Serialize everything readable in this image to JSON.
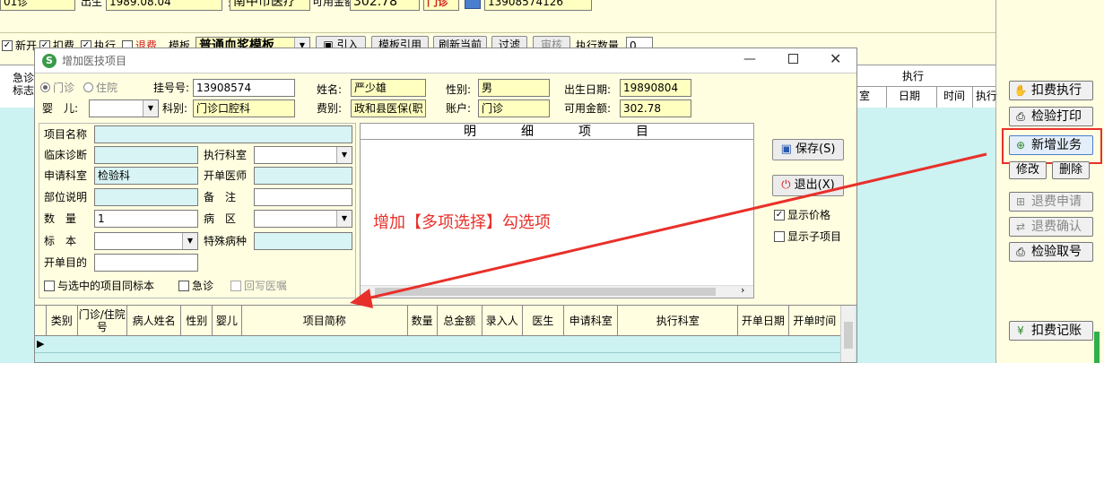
{
  "main": {
    "top_fields": [
      "01诊",
      "出生",
      "1989.08.04",
      "费别",
      "南中市医疗",
      "可用金额",
      "302.78",
      "门诊",
      "13908574126"
    ],
    "toolbar": {
      "new_label": "新开",
      "fee_label": "扣费",
      "exec_label": "执行",
      "refund_label": "退费",
      "template_label": "模板",
      "template_value": "普通血浆模板",
      "import_label": "引入",
      "template_ref_label": "模板引用",
      "refresh_label": "刷新当前",
      "filter_label": "过滤",
      "audit_label": "审核",
      "exec_count_label": "执行数量",
      "exec_count_value": "0"
    },
    "grid": {
      "left_header_1": "急诊",
      "left_header_2": "标志",
      "exec_group": "执行",
      "exec_cols": [
        "室",
        "日期",
        "时间",
        "执行"
      ]
    },
    "side_buttons": {
      "fee_exec": "扣费执行",
      "lab_print": "检验打印",
      "new_business": "新增业务",
      "modify": "修改",
      "delete": "删除",
      "refund_apply": "退费申请",
      "refund_confirm": "退费确认",
      "lab_number": "检验取号",
      "fee_record": "扣费记账"
    }
  },
  "dialog": {
    "title": "增加医技项目",
    "patient": {
      "outpatient_label": "门诊",
      "inpatient_label": "住院",
      "reg_no_label": "挂号号:",
      "reg_no": "13908574",
      "name_label": "姓名:",
      "name": "严少雄",
      "gender_label": "性别:",
      "gender": "男",
      "birth_label": "出生日期:",
      "birth": "19890804",
      "baby_label": "婴　儿:",
      "dept_label": "科别:",
      "dept": "门诊口腔科",
      "fee_type_label": "费别:",
      "fee_type": "政和县医保(职",
      "account_label": "账户:",
      "account": "门诊",
      "balance_label": "可用金额:",
      "balance": "302.78"
    },
    "form": {
      "item_name_label": "项目名称",
      "diagnosis_label": "临床诊断",
      "exec_dept_label": "执行科室",
      "apply_dept_label": "申请科室",
      "apply_dept": "检验科",
      "doctor_label": "开单医师",
      "site_label": "部位说明",
      "remark_label": "备　注",
      "qty_label": "数　量",
      "qty": "1",
      "ward_label": "病　区",
      "specimen_label": "标　本",
      "disease_label": "特殊病种",
      "purpose_label": "开单目的",
      "same_specimen_label": "与选中的项目同标本",
      "urgent_label": "急诊",
      "write_back_label": "回写医嘱"
    },
    "detail_header": [
      "明",
      "细",
      "项",
      "目"
    ],
    "buttons": {
      "save": "保存(S)",
      "exit": "退出(X)",
      "show_price": "显示价格",
      "show_sub": "显示子项目"
    },
    "table_headers": [
      "类别",
      "门诊/住院号",
      "病人姓名",
      "性别",
      "婴儿",
      "项目简称",
      "数量",
      "总金额",
      "录入人",
      "医生",
      "申请科室",
      "执行科室",
      "开单日期",
      "开单时间"
    ]
  },
  "annotation": {
    "text": "增加【多项选择】勾选项",
    "color": "#e8302a"
  }
}
